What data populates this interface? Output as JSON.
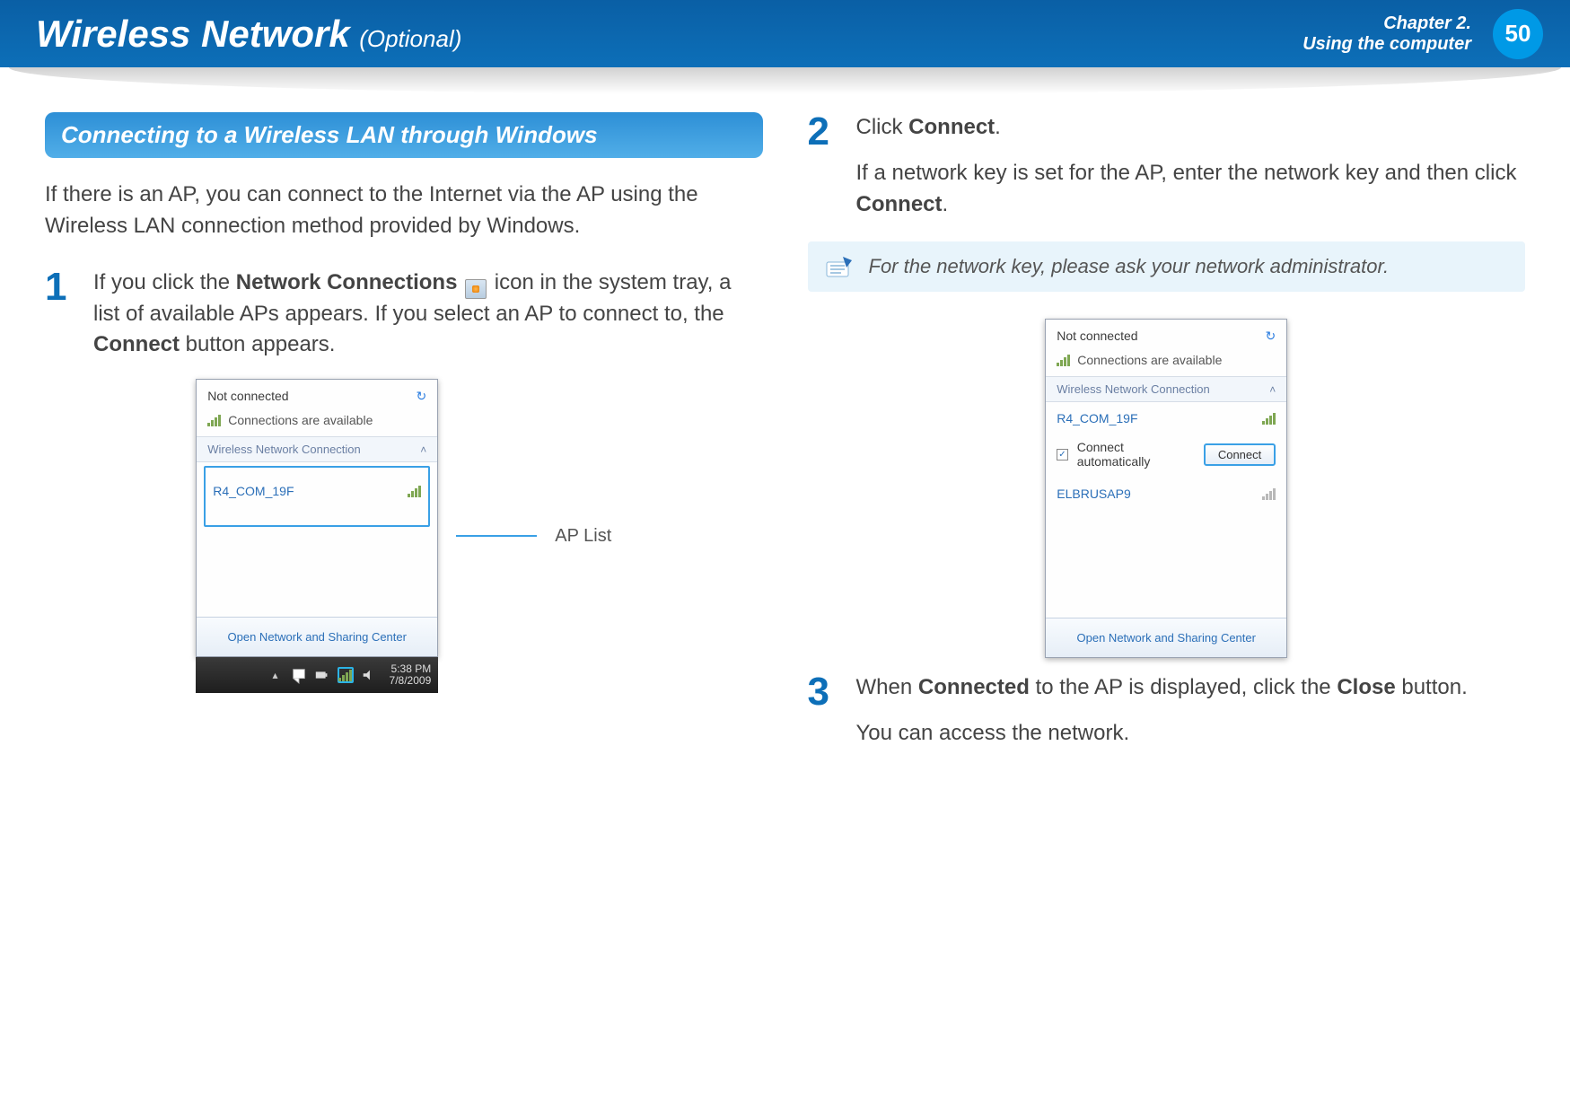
{
  "header": {
    "title": "Wireless Network",
    "subtitle": "(Optional)",
    "chapter_line1": "Chapter 2.",
    "chapter_line2": "Using the computer",
    "page_number": "50"
  },
  "left": {
    "section_title": "Connecting to a Wireless LAN through Windows",
    "intro": "If there is an AP, you can connect to the Internet via the AP using the Wireless LAN connection method provided by Windows.",
    "step1": {
      "num": "1",
      "text_pre": "If you click the ",
      "bold1": "Network Connections",
      "text_mid": " icon in the system tray, a list of available APs appears. If you select an AP to connect to, the ",
      "bold2": "Connect",
      "text_post": " button appears."
    },
    "callout": "AP List",
    "popup1": {
      "not_connected": "Not connected",
      "connections_available": "Connections are available",
      "section_label": "Wireless Network Connection",
      "ap1": "R4_COM_19F",
      "footer": "Open Network and Sharing Center",
      "time": "5:38 PM",
      "date": "7/8/2009"
    }
  },
  "right": {
    "step2": {
      "num": "2",
      "line1_pre": "Click ",
      "line1_bold": "Connect",
      "line1_post": ".",
      "line2_pre": "If a network key is set for the AP, enter the network key and then click ",
      "line2_bold": "Connect",
      "line2_post": "."
    },
    "info_note": "For the network key, please ask your network administrator.",
    "popup2": {
      "not_connected": "Not connected",
      "connections_available": "Connections are available",
      "section_label": "Wireless Network Connection",
      "ap1": "R4_COM_19F",
      "connect_auto": "Connect automatically",
      "connect_btn": "Connect",
      "ap2": "ELBRUSAP9",
      "footer": "Open Network and Sharing Center"
    },
    "step3": {
      "num": "3",
      "line1_pre": "When ",
      "line1_bold1": "Connected",
      "line1_mid": " to the AP is displayed, click the ",
      "line1_bold2": "Close",
      "line1_post": " button.",
      "line2": "You can access the network."
    }
  }
}
